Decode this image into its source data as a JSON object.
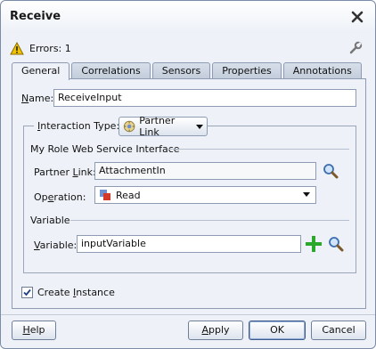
{
  "window": {
    "title": "Receive"
  },
  "status": {
    "errors_label": "Errors: 1"
  },
  "tabs": [
    {
      "label": "General",
      "active": true
    },
    {
      "label": "Correlations",
      "active": false
    },
    {
      "label": "Sensors",
      "active": false
    },
    {
      "label": "Properties",
      "active": false
    },
    {
      "label": "Annotations",
      "active": false
    }
  ],
  "general": {
    "name_label_u": "N",
    "name_label_rest": "ame:",
    "name_value": "ReceiveInput",
    "interaction_type_label_u": "I",
    "interaction_type_label_rest": "nteraction Type:",
    "interaction_type_value": "Partner Link",
    "my_role_title": "My Role Web Service Interface",
    "partner_link_label_a": "Partner ",
    "partner_link_label_u": "L",
    "partner_link_label_b": "ink:",
    "partner_link_value": "AttachmentIn",
    "operation_label_a": "Op",
    "operation_label_u": "e",
    "operation_label_b": "ration:",
    "operation_value": "Read",
    "variable_title": "Variable",
    "variable_label_u": "V",
    "variable_label_rest": "ariable:",
    "variable_value": "inputVariable",
    "create_instance_label_a": "Create ",
    "create_instance_label_u": "I",
    "create_instance_label_b": "nstance",
    "create_instance_checked": true
  },
  "buttons": {
    "help_u": "H",
    "help_rest": "elp",
    "apply_u": "A",
    "apply_rest": "pply",
    "ok": "OK",
    "cancel": "Cancel"
  },
  "colors": {
    "accent": "#3e5b8a",
    "warning": "#f2c200",
    "add_green": "#2aa82a",
    "operation_icon_red": "#d2392b"
  }
}
